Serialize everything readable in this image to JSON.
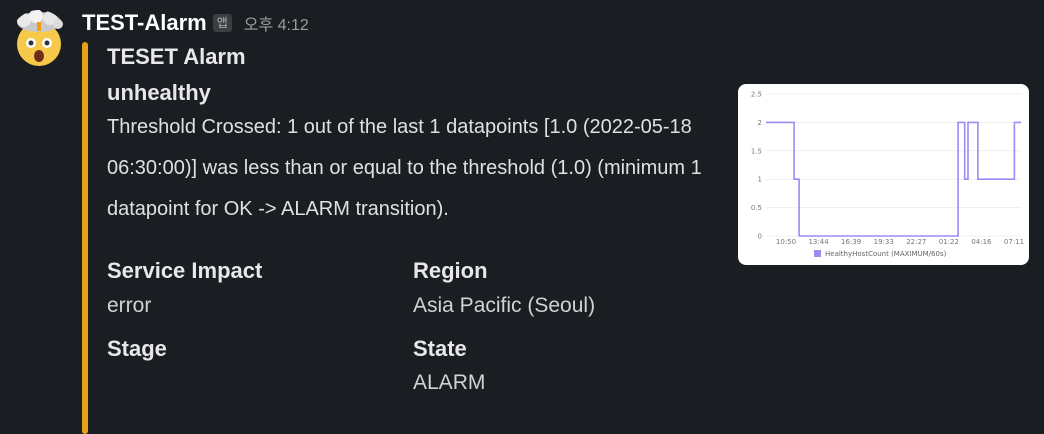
{
  "message": {
    "app_name": "TEST-Alarm",
    "app_badge": "앱",
    "timestamp": "오후 4:12",
    "avatar_icon": "exploding-head-emoji-icon"
  },
  "attachment": {
    "accent_color": "#e5a11a",
    "title": "TESET Alarm",
    "status": "unhealthy",
    "description": "Threshold Crossed: 1 out of the last 1 datapoints [1.0 (2022-05-18 06:30:00)] was less than or equal to the threshold (1.0) (minimum 1 datapoint for OK -> ALARM transition).",
    "fields": [
      {
        "label": "Service Impact",
        "value": "error"
      },
      {
        "label": "Region",
        "value": "Asia Pacific (Seoul)"
      },
      {
        "label": "Stage",
        "value": ""
      },
      {
        "label": "State",
        "value": "ALARM"
      }
    ]
  },
  "chart_data": {
    "type": "line",
    "x_tick_labels": [
      "10:50",
      "13:44",
      "16:39",
      "19:33",
      "22:27",
      "01:22",
      "04:16",
      "07:11"
    ],
    "y_tick_labels": [
      "0",
      "0.5",
      "1",
      "1.5",
      "2",
      "2.5"
    ],
    "ylim": [
      0,
      2.5
    ],
    "series": [
      {
        "name": "HealthyHostCount (MAXIMUM/60s)",
        "color": "#9b8cf5",
        "points": [
          [
            0,
            2
          ],
          [
            1.7,
            2
          ],
          [
            1.7,
            1
          ],
          [
            2.0,
            1
          ],
          [
            2.0,
            0
          ],
          [
            11.6,
            0
          ],
          [
            11.6,
            2
          ],
          [
            12.0,
            2
          ],
          [
            12.0,
            1
          ],
          [
            12.2,
            1
          ],
          [
            12.2,
            2
          ],
          [
            12.8,
            2
          ],
          [
            12.8,
            1
          ],
          [
            15.0,
            1
          ],
          [
            15.0,
            2
          ],
          [
            15.4,
            2
          ]
        ]
      }
    ],
    "x_range": [
      0,
      15.4
    ]
  }
}
